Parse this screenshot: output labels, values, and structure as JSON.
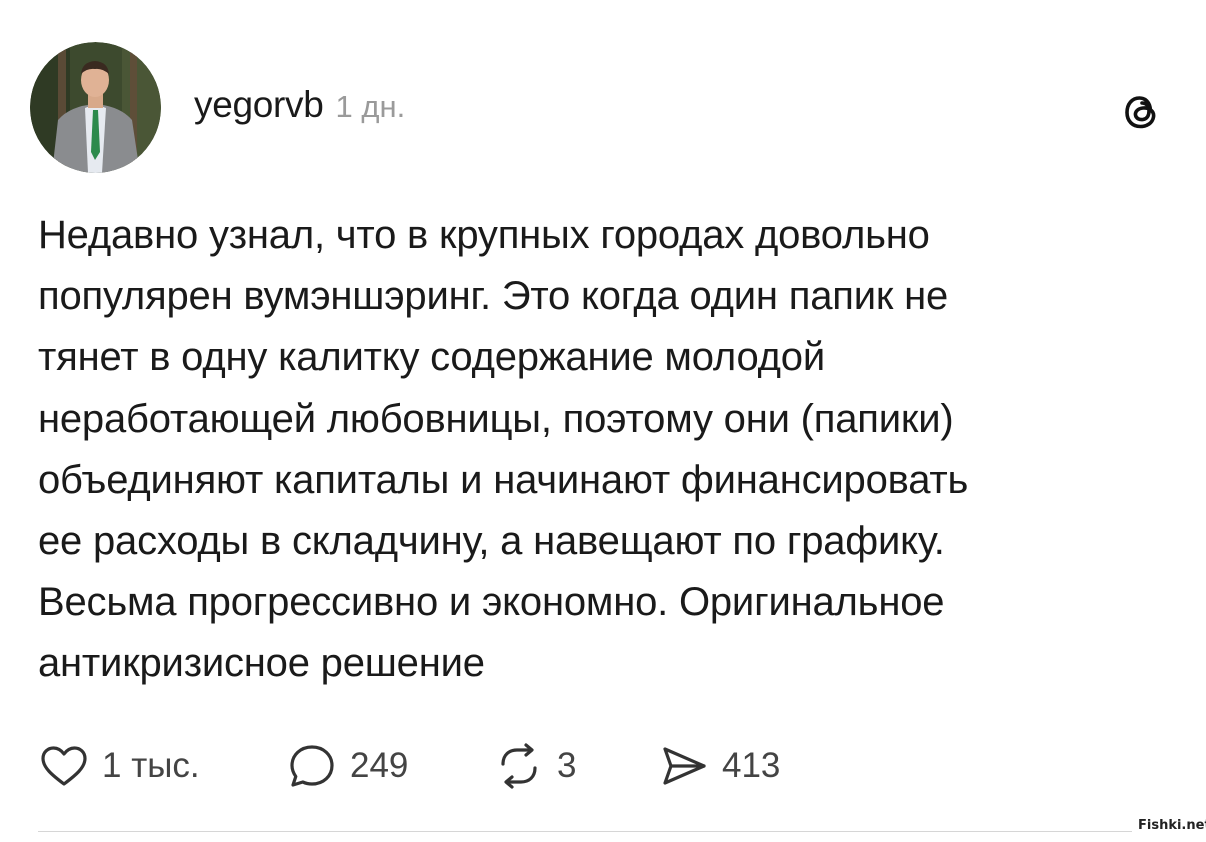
{
  "post": {
    "username": "yegorvb",
    "timestamp": "1 дн.",
    "text": "Недавно узнал, что в крупных городах довольно\nпопулярен вумэншэринг. Это когда один папик не\nтянет в одну калитку содержание молодой\nнеработающей любовницы, поэтому они (папики)\nобъединяют капиталы и начинают финансировать\nее расходы в складчину, а навещают по графику.\nВесьма прогрессивно и экономно. Оригинальное\nантикризисное решение",
    "avatar_icon": "user-avatar",
    "app_icon": "threads-icon"
  },
  "actions": {
    "likes": "1 тыс.",
    "replies": "249",
    "reposts": "3",
    "shares": "413"
  },
  "watermark": "Fishki.net",
  "colors": {
    "text": "#1a1a1a",
    "muted": "#9a9a9a",
    "divider": "#d6d6d6"
  }
}
